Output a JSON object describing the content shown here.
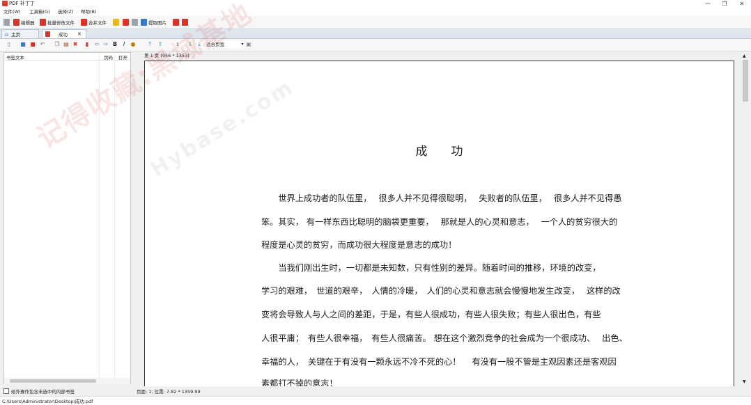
{
  "window": {
    "title": "PDF 补丁丁",
    "controls": [
      "—",
      "❐",
      "✕"
    ]
  },
  "menu": [
    "文件(W)",
    "工具箱(G)",
    "选择(Z)",
    "帮助(B)"
  ],
  "toolbar1": {
    "editor": "编辑器",
    "batch_modify": "批量修改文件",
    "merge": "合并文件",
    "extract_images": "提取图片"
  },
  "tabs": [
    {
      "label": "主页",
      "icon": "home-icon"
    },
    {
      "label": "成功",
      "icon": "pdf-icon",
      "close": "✕"
    }
  ],
  "toolbar2": {
    "page_number": "1",
    "zoom_mode": "适合页宽"
  },
  "bookmark_panel": {
    "columns": [
      "书签文本",
      "页码",
      "打开"
    ],
    "checkbox_label": "给外操作包含未选中的内部书签"
  },
  "document": {
    "page_label": "第 1 页 (956 * 1353)",
    "title": "成功",
    "lines": [
      "　　世界上成功者的队伍里，　 很多人并不见得很聪明，　 失败者的队伍里，　 很多人并不见得愚",
      "笨。其实， 有一样东西比聪明的脑袋更重要，　 那就是人的心灵和意志，　 一个人的贫穷很大的",
      "程度是心灵的贫穷，而成功很大程度是意志的成功！",
      "　　当我们刚出生时，一切都是未知数，只有性别的差异。随着时间的推移，环境的改变，",
      "学习的艰难，　世道的艰辛，　人情的冷暖，　人们的心灵和意志就会慢慢地发生改变，　 这样的改",
      "变将会导致人与人之间的差距，于是，有些人很成功，有些人很失败；有些人很出色，有些",
      "人很平庸；　有些人很幸福，　有些人很痛苦。 想在这个激烈竞争的社会成为一个很成功、　 出色、",
      "幸福的人，　关键在于有没有一颗永远不冷不死的心！　 有没有一股不管是主观因素还是客观因",
      "素都打不掉的意志！"
    ]
  },
  "watermark": {
    "main": "记得收藏:黑域基地",
    "sub": "Hybase.com"
  },
  "status": {
    "position": "页面: 1; 位置: 7.82 * 1359.99",
    "path": "C:\\Users\\Administrator\\Desktop\\成功.pdf"
  },
  "colors": {
    "accent_red": "#d9342b",
    "accent_blue": "#3a78c9"
  }
}
